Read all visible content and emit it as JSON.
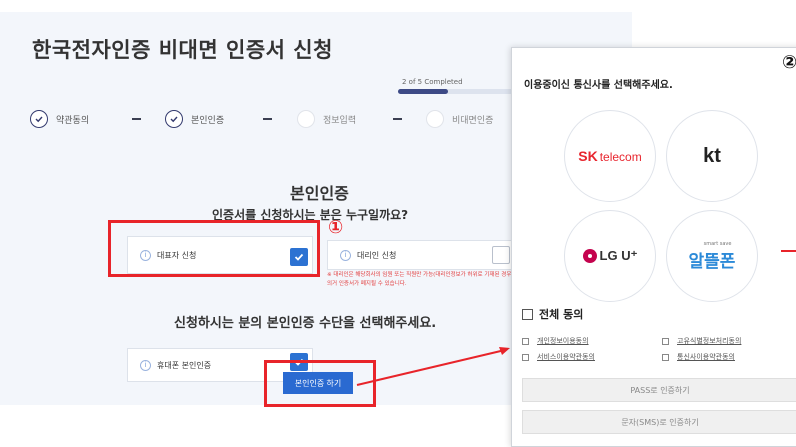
{
  "page": {
    "title": "한국전자인증 비대면 인증서 신청"
  },
  "progress": {
    "text": "2 of 5 Completed",
    "fraction": 0.4
  },
  "steps": [
    {
      "label": "약관동의",
      "done": true
    },
    {
      "label": "본인인증",
      "done": true
    },
    {
      "label": "정보입력",
      "done": false
    },
    {
      "label": "비대면인증",
      "done": false
    }
  ],
  "main": {
    "heading": "본인인증",
    "question": "인증서를 신청하시는 분은 누구일까요?",
    "options": [
      {
        "label": "대표자 신청",
        "checked": true
      },
      {
        "label": "대리인 신청",
        "checked": false
      }
    ],
    "notice": "※ 대리인은 해당회사의 임원 또는 직원만 가능(대리인정보가 허위로 기재된 경우 약관에 의거 인증서가 폐지될 수 있습니다.",
    "method_heading": "신청하시는 분의 본인인증 수단을 선택해주세요.",
    "method_option": {
      "label": "휴대폰 본인인증",
      "checked": true
    },
    "auth_button": "본인인증 하기"
  },
  "annotations": {
    "marker1": "①",
    "marker2": "②",
    "accent": "#e8242a"
  },
  "popup": {
    "title": "이용중이신 통신사를 선택해주세요.",
    "carriers": {
      "sk_main": "SK",
      "sk_sub": "telecom",
      "kt": "kt",
      "lg": "LG U⁺",
      "altteul_small": "smart save",
      "altteul": "알뜰폰"
    },
    "all_agree": "전체 동의",
    "terms": [
      "개인정보이용동의",
      "고유식별정보처리동의",
      "서비스이용약관동의",
      "통신사이용약관동의"
    ],
    "pass_button": "PASS로 인증하기",
    "sms_button": "문자(SMS)로 인증하기"
  },
  "colors": {
    "primary": "#2c72d2",
    "navy": "#333a6e",
    "sk_red": "#e8262f",
    "lg_magenta": "#c4034e",
    "altteul_blue": "#2c8ad8"
  }
}
